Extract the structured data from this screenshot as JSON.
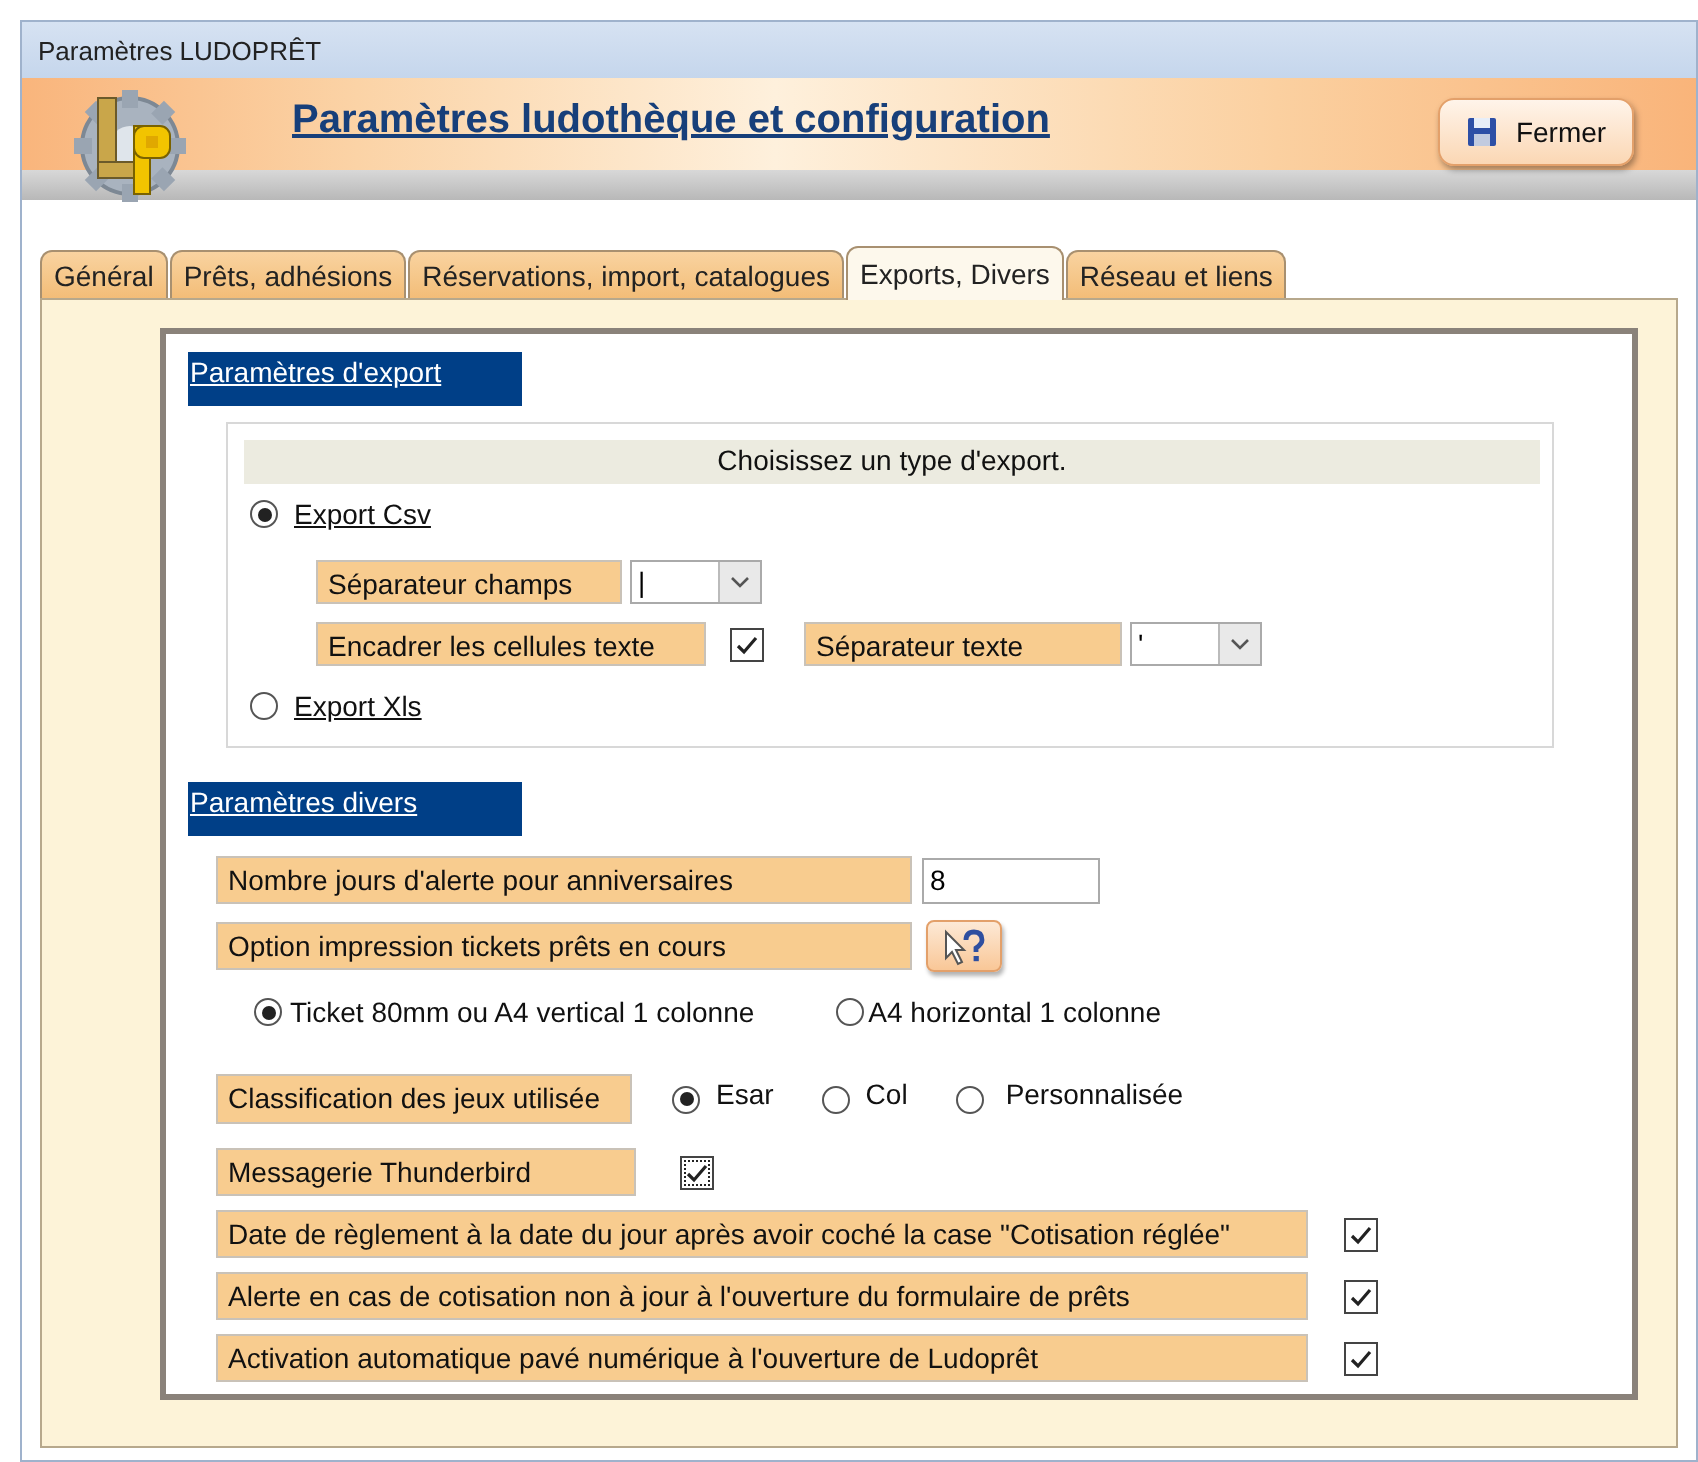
{
  "window": {
    "title": "Paramètres LUDOPRÊT"
  },
  "header": {
    "title": "Paramètres ludothèque et configuration",
    "close_button": "Fermer"
  },
  "tabs": [
    {
      "label": "Général",
      "selected": false
    },
    {
      "label": "Prêts, adhésions",
      "selected": false
    },
    {
      "label": "Réservations,  import, catalogues",
      "selected": false
    },
    {
      "label": "Exports, Divers",
      "selected": true
    },
    {
      "label": "Réseau et liens",
      "selected": false
    }
  ],
  "export_section": {
    "title": "Paramètres d'export",
    "prompt": "Choisissez un type d'export.",
    "csv": {
      "label": "Export Csv",
      "selected": true
    },
    "field_separator": {
      "label": "Séparateur champs",
      "value": "|"
    },
    "frame_text_cells": {
      "label": "Encadrer les cellules texte",
      "checked": true
    },
    "text_separator": {
      "label": "Séparateur texte",
      "value": "'"
    },
    "xls": {
      "label": "Export Xls",
      "selected": false
    }
  },
  "misc_section": {
    "title": "Paramètres divers",
    "birthday_alert": {
      "label": "Nombre jours d'alerte pour anniversaires",
      "value": "8"
    },
    "ticket_option": {
      "label": "Option impression tickets prêts en cours"
    },
    "ticket_formats": [
      {
        "label": "Ticket 80mm ou A4 vertical 1 colonne",
        "selected": true
      },
      {
        "label": "A4 horizontal 1 colonne",
        "selected": false
      }
    ],
    "classification": {
      "label": "Classification des jeux utilisée",
      "options": [
        {
          "label": "Esar",
          "selected": true
        },
        {
          "label": "Col",
          "selected": false
        },
        {
          "label": "Personnalisée",
          "selected": false
        }
      ]
    },
    "checks": [
      {
        "label": "Messagerie Thunderbird",
        "kind": "short",
        "checked": true,
        "focused": true
      },
      {
        "label": "Date de règlement à la date du jour après avoir coché la case \"Cotisation réglée\"",
        "kind": "long",
        "checked": true,
        "focused": false
      },
      {
        "label": "Alerte en cas de cotisation non à jour à l'ouverture du formulaire de prêts",
        "kind": "long",
        "checked": true,
        "focused": false
      },
      {
        "label": "Activation automatique pavé numérique à l'ouverture de Ludoprêt",
        "kind": "long",
        "checked": true,
        "focused": false
      }
    ]
  }
}
